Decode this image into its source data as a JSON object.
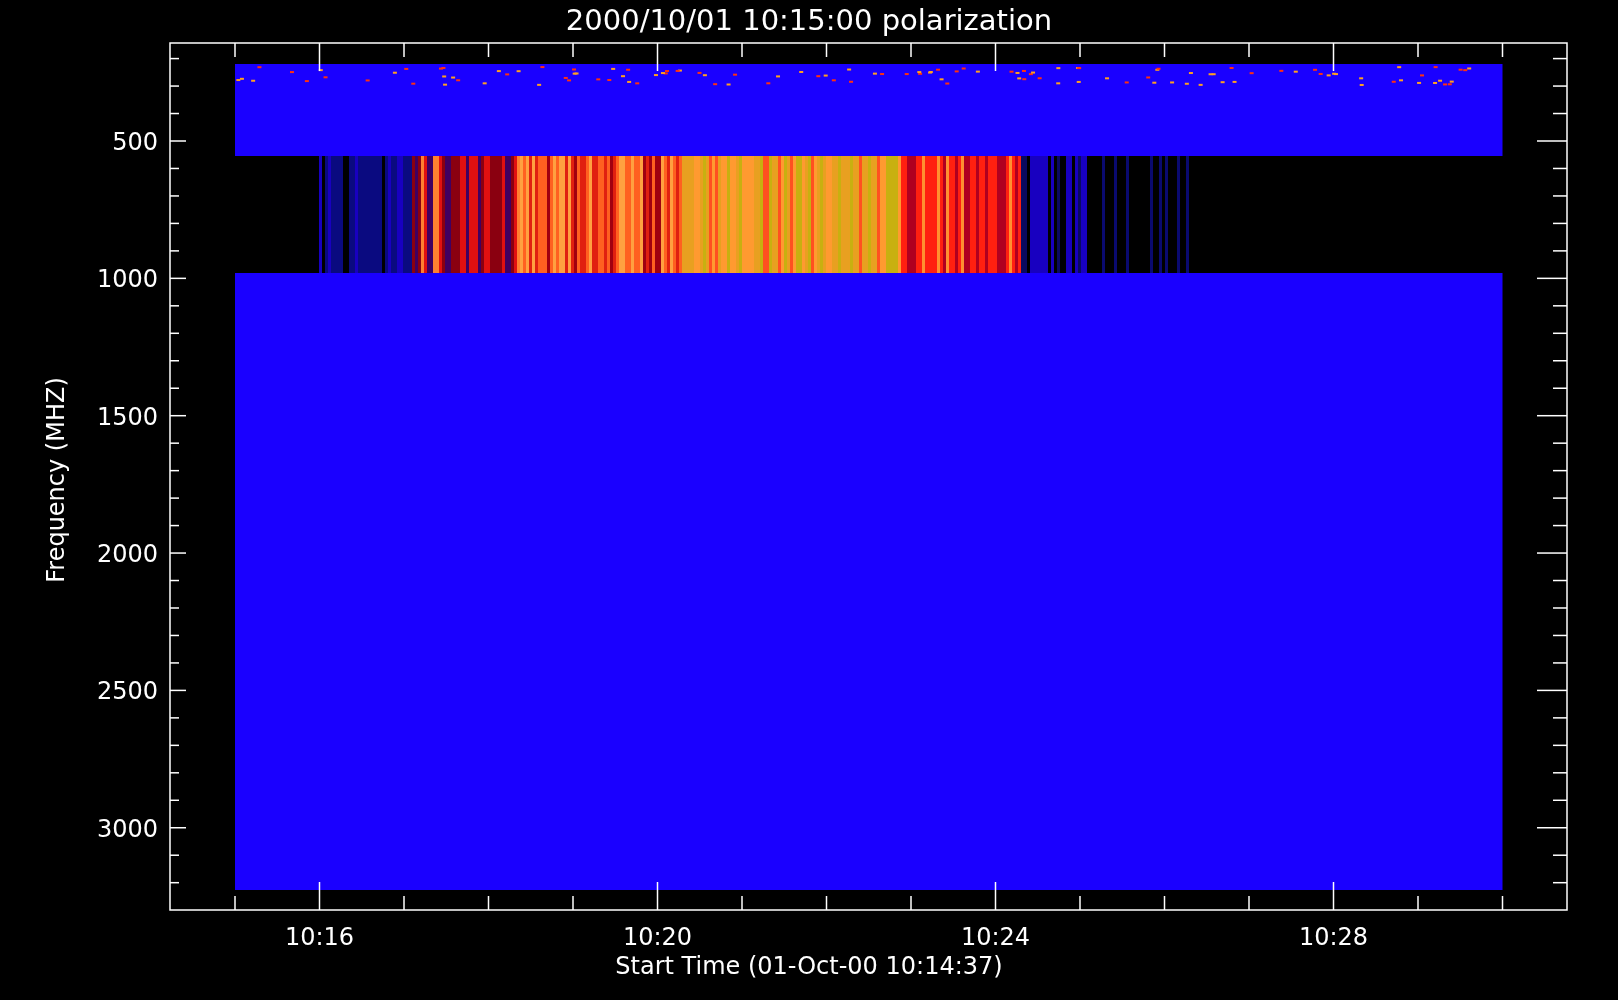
{
  "title": "2000/10/01 10:15:00 polarization",
  "ylabel": "Frequency (MHZ)",
  "xlabel": "Start Time (01-Oct-00 10:14:37)",
  "yticks": [
    "500",
    "1000",
    "1500",
    "2000",
    "2500",
    "3000"
  ],
  "xticks": [
    "10:16",
    "10:20",
    "10:24",
    "10:28"
  ]
}
